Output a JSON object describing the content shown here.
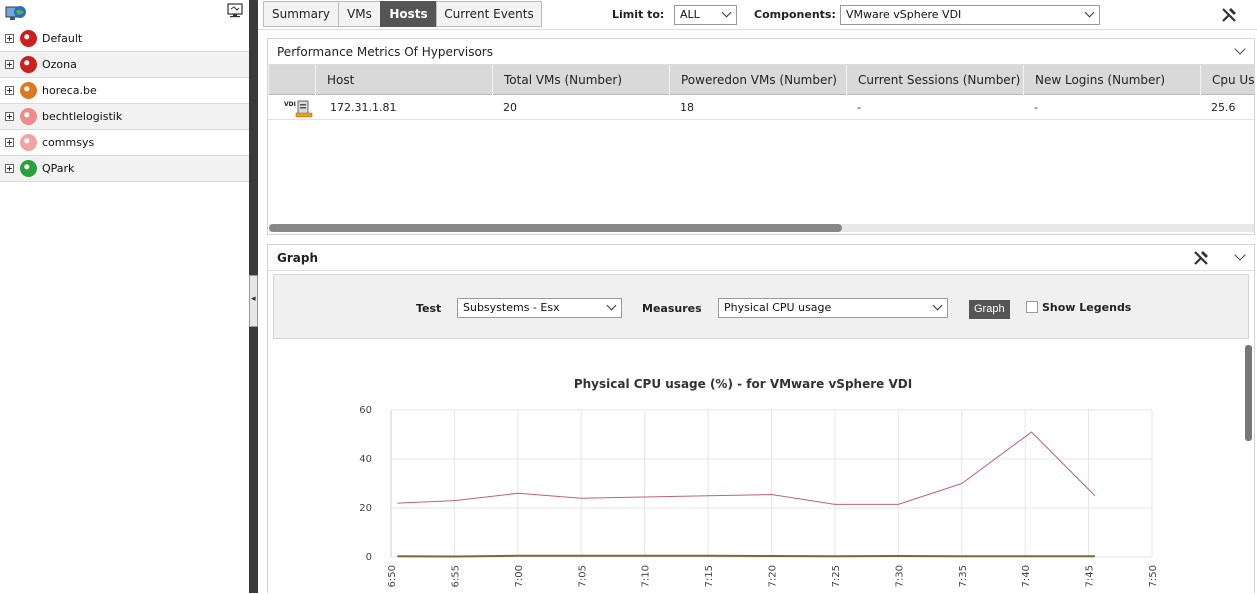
{
  "sidebar": {
    "items": [
      {
        "label": "Default",
        "color": "#cc1f1f"
      },
      {
        "label": "Ozona",
        "color": "#cc1f1f"
      },
      {
        "label": "horeca.be",
        "color": "#e07820"
      },
      {
        "label": "bechtlelogistik",
        "color": "#f08b8b"
      },
      {
        "label": "commsys",
        "color": "#f3a3a3"
      },
      {
        "label": "QPark",
        "color": "#2aa03a"
      }
    ]
  },
  "tabs": [
    "Summary",
    "VMs",
    "Hosts",
    "Current Events"
  ],
  "active_tab": "Hosts",
  "controls": {
    "limit_label": "Limit to:",
    "limit_value": "ALL",
    "components_label": "Components:",
    "components_value": "VMware vSphere VDI"
  },
  "metrics_panel": {
    "title": "Performance Metrics Of Hypervisors",
    "columns": [
      "Host",
      "Total VMs (Number)",
      "Poweredon VMs (Number)",
      "Current Sessions (Number)",
      "New Logins (Number)",
      "Cpu Us"
    ],
    "icon_badge": "VDI",
    "rows": [
      {
        "host": "172.31.1.81",
        "total_vms": "20",
        "poweredon_vms": "18",
        "current_sessions": "-",
        "new_logins": "-",
        "cpu": "25.6"
      }
    ]
  },
  "graph_panel": {
    "title": "Graph",
    "test_label": "Test",
    "test_value": "Subsystems - Esx",
    "measures_label": "Measures",
    "measures_value": "Physical CPU usage",
    "graph_button": "Graph",
    "show_legends_label": "Show Legends"
  },
  "chart_data": {
    "type": "line",
    "title": "Physical CPU usage (%) - for VMware vSphere VDI",
    "x": [
      "6:50",
      "6:55",
      "7:00",
      "7:05",
      "7:10",
      "7:15",
      "7:20",
      "7:25",
      "7:30",
      "7:35",
      "7:40",
      "7:45",
      "7:50"
    ],
    "x_minutes": [
      0,
      5,
      10,
      15,
      20,
      25,
      30,
      35,
      40,
      45,
      50,
      55,
      60
    ],
    "ylim": [
      0,
      60
    ],
    "yticks": [
      0,
      20,
      40,
      60
    ],
    "grid": true,
    "series": [
      {
        "color": "#c0607a",
        "points": [
          [
            0.5,
            22
          ],
          [
            5,
            23
          ],
          [
            10,
            26
          ],
          [
            15,
            24
          ],
          [
            20,
            24.5
          ],
          [
            25,
            25
          ],
          [
            30,
            25.5
          ],
          [
            35,
            21.5
          ],
          [
            40,
            21.5
          ],
          [
            45,
            30
          ],
          [
            50.5,
            51
          ],
          [
            55.5,
            25
          ]
        ]
      },
      {
        "color": "#7a6a30",
        "points": [
          [
            0.5,
            0.3
          ],
          [
            5,
            0.2
          ],
          [
            10,
            0.5
          ],
          [
            15,
            0.5
          ],
          [
            20,
            0.5
          ],
          [
            25,
            0.5
          ],
          [
            30,
            0.4
          ],
          [
            35,
            0.3
          ],
          [
            40,
            0.4
          ],
          [
            45,
            0.3
          ],
          [
            50.5,
            0.3
          ],
          [
            55.5,
            0.3
          ]
        ]
      }
    ]
  }
}
